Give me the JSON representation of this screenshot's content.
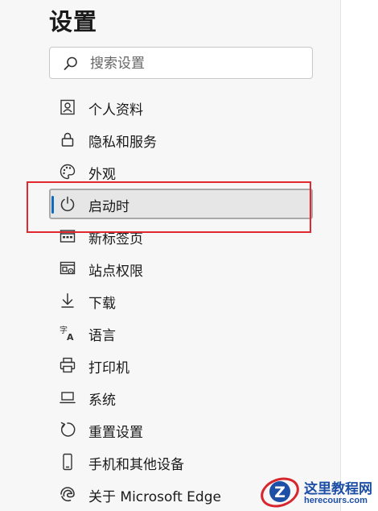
{
  "settings": {
    "title": "设置",
    "search": {
      "placeholder": "搜索设置"
    },
    "nav": [
      {
        "label": "个人资料",
        "icon": "profile-icon"
      },
      {
        "label": "隐私和服务",
        "icon": "lock-icon"
      },
      {
        "label": "外观",
        "icon": "palette-icon"
      },
      {
        "label": "启动时",
        "icon": "power-icon",
        "selected": true
      },
      {
        "label": "新标签页",
        "icon": "new-tab-icon"
      },
      {
        "label": "站点权限",
        "icon": "site-permissions-icon"
      },
      {
        "label": "下载",
        "icon": "download-icon"
      },
      {
        "label": "语言",
        "icon": "language-icon"
      },
      {
        "label": "打印机",
        "icon": "printer-icon"
      },
      {
        "label": "系统",
        "icon": "system-icon"
      },
      {
        "label": "重置设置",
        "icon": "reset-icon"
      },
      {
        "label": "手机和其他设备",
        "icon": "phone-icon"
      },
      {
        "label": "关于 Microsoft Edge",
        "icon": "edge-icon"
      }
    ]
  },
  "watermark": {
    "logo_letter": "Z",
    "title": "这里教程网",
    "url": "herecours.com"
  },
  "colors": {
    "accent": "#0f6cbd",
    "highlight_border": "#e0282e",
    "watermark": "#1d4fa6"
  }
}
